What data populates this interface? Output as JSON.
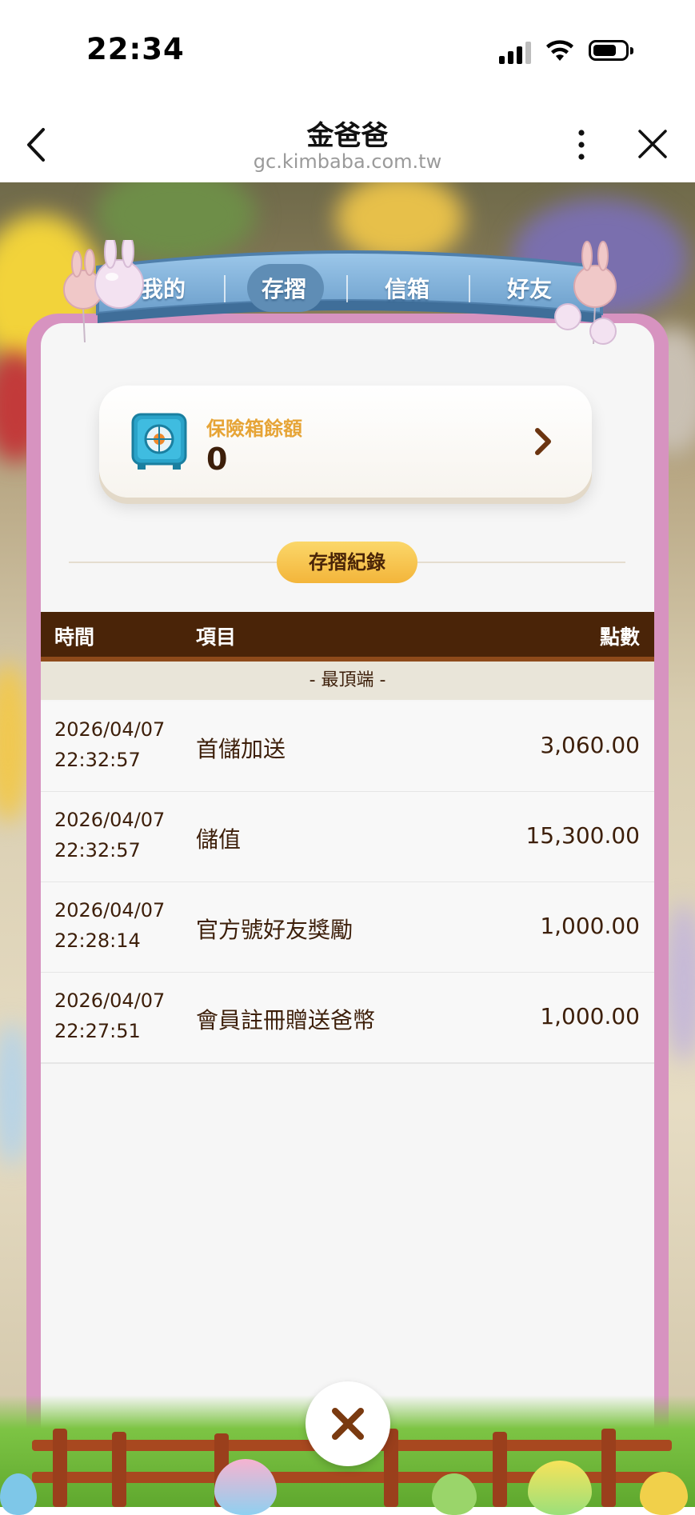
{
  "status_bar": {
    "time": "22:34"
  },
  "browser": {
    "title": "金爸爸",
    "url": "gc.kimbaba.com.tw"
  },
  "tabs": [
    {
      "label": "我的",
      "active": false
    },
    {
      "label": "存摺",
      "active": true
    },
    {
      "label": "信箱",
      "active": false
    },
    {
      "label": "好友",
      "active": false
    }
  ],
  "safe": {
    "label": "保險箱餘額",
    "amount": "0"
  },
  "section": {
    "title": "存摺紀錄"
  },
  "table": {
    "headers": {
      "time": "時間",
      "item": "項目",
      "points": "點數"
    },
    "top_marker": "- 最頂端 -",
    "rows": [
      {
        "date": "2026/04/07",
        "time": "22:32:57",
        "item": "首儲加送",
        "points": "3,060.00"
      },
      {
        "date": "2026/04/07",
        "time": "22:32:57",
        "item": "儲值",
        "points": "15,300.00"
      },
      {
        "date": "2026/04/07",
        "time": "22:28:14",
        "item": "官方號好友獎勵",
        "points": "1,000.00"
      },
      {
        "date": "2026/04/07",
        "time": "22:27:51",
        "item": "會員註冊贈送爸幣",
        "points": "1,000.00"
      }
    ]
  },
  "colors": {
    "accent_gold": "#e6a436",
    "brown": "#3d1f0a",
    "header_brown": "#4a2408",
    "frame_pink": "#d793c0",
    "ribbon_blue": "#7aaed8"
  }
}
